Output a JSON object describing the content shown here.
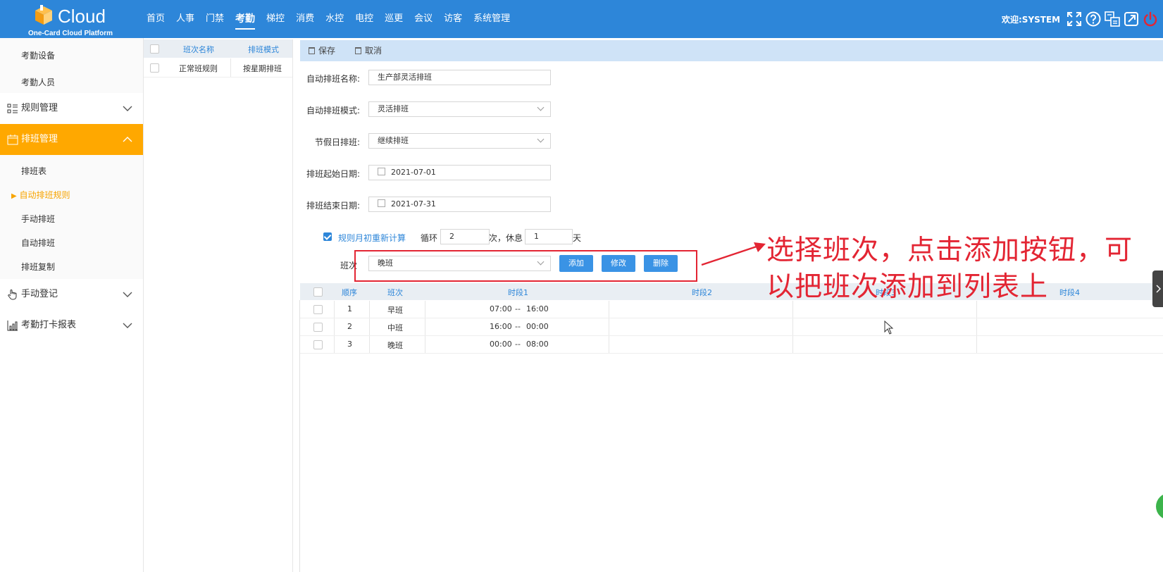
{
  "app": {
    "logo_text": "Cloud",
    "logo_subtitle": "One-Card Cloud Platform",
    "welcome": "欢迎:SYSTEM"
  },
  "nav": {
    "items": [
      "首页",
      "人事",
      "门禁",
      "考勤",
      "梯控",
      "消费",
      "水控",
      "电控",
      "巡更",
      "会议",
      "访客",
      "系统管理"
    ],
    "active": "考勤"
  },
  "top_icons": [
    "fullscreen-icon",
    "help-icon",
    "language-icon",
    "external-link-icon",
    "power-icon"
  ],
  "sidebar": {
    "sub_top": [
      "考勤设备",
      "考勤人员"
    ],
    "group_rules": "规则管理",
    "group_schedule": "排班管理",
    "schedule_items": [
      "排班表",
      "自动排班规则",
      "手动排班",
      "自动排班",
      "排班复制"
    ],
    "active_item": "自动排班规则",
    "group_manual": "手动登记",
    "group_report": "考勤打卡报表"
  },
  "shift_list": {
    "headers": [
      "班次名称",
      "排班模式"
    ],
    "rows": [
      {
        "name": "正常班规则",
        "mode": "按星期排班"
      }
    ]
  },
  "toolbar": {
    "save": "保存",
    "cancel": "取消"
  },
  "form": {
    "name_label": "自动排班名称:",
    "name_value": "生产部灵活排班",
    "mode_label": "自动排班模式:",
    "mode_value": "灵活排班",
    "holiday_label": "节假日排班:",
    "holiday_value": "继续排班",
    "start_label": "排班起始日期:",
    "start_value": "2021-07-01",
    "end_label": "排班结束日期:",
    "end_value": "2021-07-31",
    "recalc_label": "规则月初重新计算",
    "cycle_label": "循环",
    "cycle_value": "2",
    "cycle_unit_rest": "次，休息",
    "rest_value": "1",
    "rest_unit": "天",
    "shift_label": "班次",
    "shift_value": "晚班",
    "add": "添加",
    "edit": "修改",
    "delete": "删除"
  },
  "table": {
    "headers": [
      "顺序",
      "班次",
      "时段1",
      "时段2",
      "时段3",
      "时段4"
    ],
    "rows": [
      {
        "order": "1",
        "shift": "早班",
        "t1_start": "07:00",
        "t1_end": "16:00"
      },
      {
        "order": "2",
        "shift": "中班",
        "t1_start": "16:00",
        "t1_end": "00:00"
      },
      {
        "order": "3",
        "shift": "晚班",
        "t1_start": "00:00",
        "t1_end": "08:00"
      }
    ],
    "time_sep": "--"
  },
  "annotation": {
    "line1": "选择班次，点击添加按钮，可",
    "line2": "以把班次添加到列表上",
    "color": "#e32533"
  },
  "colors": {
    "primary": "#2d86d9",
    "active_orange": "#ffa800",
    "toolbar_bg": "#cfe3f7"
  }
}
